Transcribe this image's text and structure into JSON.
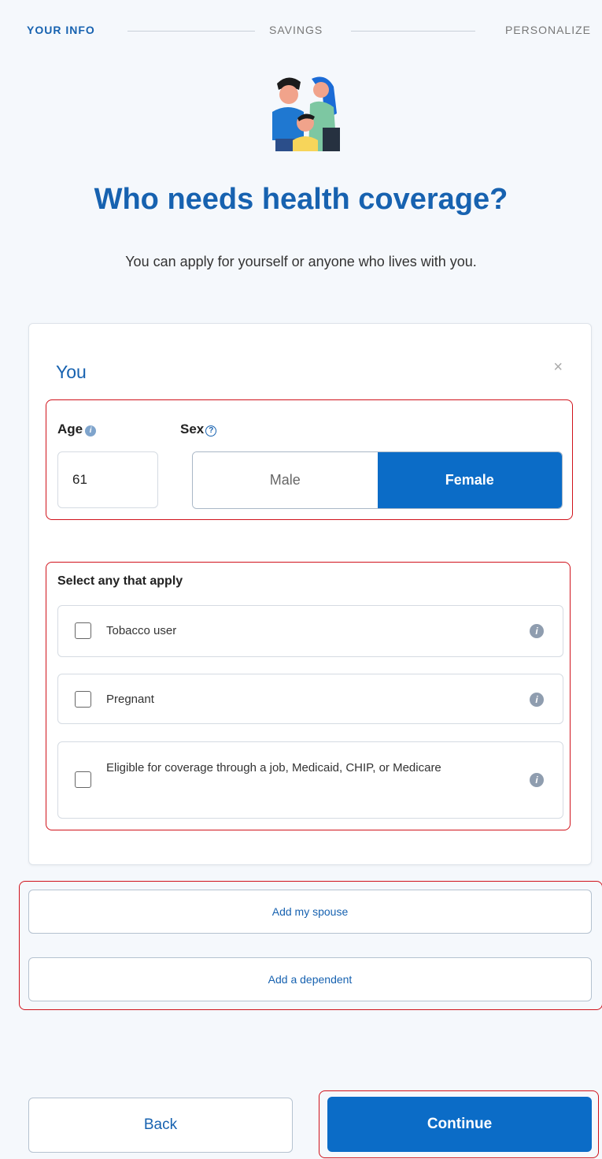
{
  "progress": {
    "steps": [
      {
        "label": "YOUR INFO",
        "active": true
      },
      {
        "label": "SAVINGS",
        "active": false
      },
      {
        "label": "PERSONALIZE",
        "active": false
      }
    ]
  },
  "illustration": {
    "icon": "family-icon"
  },
  "header": {
    "title": "Who needs health coverage?",
    "subtitle": "You can apply for yourself or anyone who lives with you."
  },
  "member": {
    "title": "You",
    "close_icon": "×",
    "age_label": "Age",
    "age_value": "61",
    "sex_label": "Sex",
    "sex_options": [
      "Male",
      "Female"
    ],
    "sex_selected": "Female",
    "select_heading": "Select any that apply",
    "options": [
      {
        "label": "Tobacco user",
        "checked": false
      },
      {
        "label": "Pregnant",
        "checked": false
      },
      {
        "label": "Eligible for coverage through a job, Medicaid, CHIP, or Medicare",
        "checked": false
      }
    ]
  },
  "add": {
    "spouse_label": "Add my spouse",
    "dependent_label": "Add a dependent"
  },
  "footer": {
    "back_label": "Back",
    "continue_label": "Continue"
  },
  "colors": {
    "primary": "#0b6cc7",
    "title_blue": "#1762b0",
    "highlight_red": "#d0121b",
    "background": "#f5f8fc"
  }
}
